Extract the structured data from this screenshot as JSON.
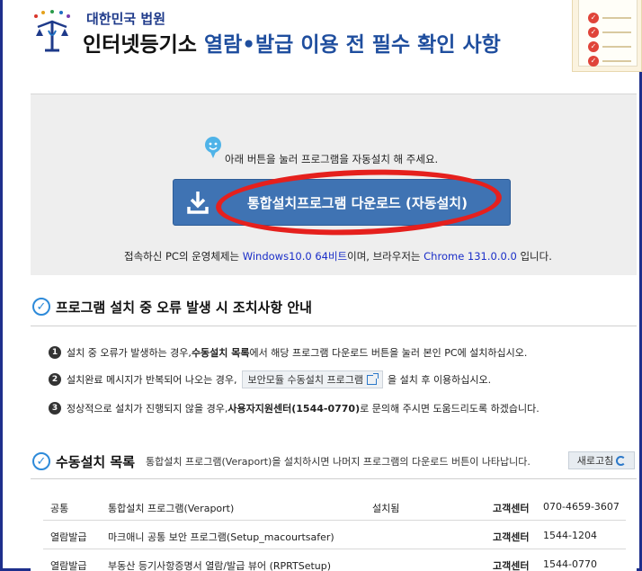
{
  "header": {
    "court_name": "대한민국 법원",
    "title_plain": "인터넷등기소 ",
    "title_accent": "열람•발급 이용 전 필수 확인 사항"
  },
  "download": {
    "notice": "아래 버튼을 눌러 프로그램을 자동설치 해 주세요.",
    "button_label": "통합설치프로그램 다운로드 (자동설치)",
    "os_prefix": "접속하신 PC의 운영체제는 ",
    "os_value": "Windows10.0 64비트",
    "os_mid": "이며, 브라우저는 ",
    "browser_value": "Chrome 131.0.0.0",
    "os_suffix": " 입니다."
  },
  "error_guide": {
    "title": "프로그램 설치 중 오류 발생 시 조치사항 안내",
    "items": [
      {
        "num": "1",
        "pre": "설치 중 오류가 발생하는 경우, ",
        "bold": "수동설치 목록",
        "post": "에서 해당 프로그램 다운로드 버튼을 눌러 본인 PC에 설치하십시오."
      },
      {
        "num": "2",
        "pre": "설치완료 메시지가 반복되어 나오는 경우,",
        "button": "보안모듈 수동설치 프로그램",
        "post": "을 설치 후 이용하십시오."
      },
      {
        "num": "3",
        "pre": "정상적으로 설치가 진행되지 않을 경우, ",
        "bold": "사용자지원센터(1544-0770)",
        "post": "로 문의해 주시면 도움드리도록 하겠습니다."
      }
    ]
  },
  "manual_list": {
    "title": "수동설치 목록",
    "subtitle": "통합설치 프로그램(Veraport)을 설치하시면 나머지 프로그램의 다운로드 버튼이 나타납니다.",
    "refresh_label": "새로고침",
    "rows": [
      {
        "category": "공통",
        "name": "통합설치 프로그램(Veraport)",
        "status": "설치됨",
        "center_label": "고객센터",
        "phone": "070-4659-3607"
      },
      {
        "category": "열람발급",
        "name": "마크애니 공통 보안 프로그램(Setup_macourtsafer)",
        "status": "",
        "center_label": "고객센터",
        "phone": "1544-1204"
      },
      {
        "category": "열람발급",
        "name": "부동산 등기사항증명서 열람/발급 뷰어 (RPRTSetup)",
        "status": "",
        "center_label": "고객센터",
        "phone": "1544-0770"
      }
    ]
  },
  "colors": {
    "accent": "#1f4e9e",
    "button": "#3f73b3",
    "highlight_ring": "#e5201d",
    "frame": "#1e2f8c"
  }
}
